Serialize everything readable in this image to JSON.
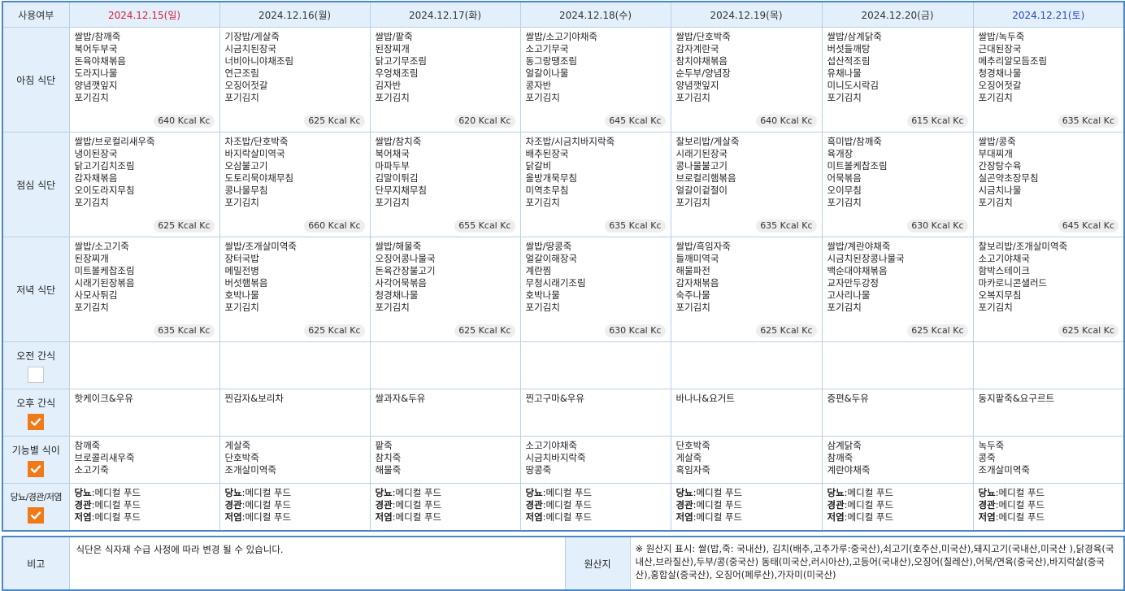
{
  "header": {
    "corner": "사용여부",
    "days": [
      {
        "date": "2024.12.15(일)",
        "type": "sun"
      },
      {
        "date": "2024.12.16(월)",
        "type": "weekday"
      },
      {
        "date": "2024.12.17(화)",
        "type": "weekday"
      },
      {
        "date": "2024.12.18(수)",
        "type": "weekday"
      },
      {
        "date": "2024.12.19(목)",
        "type": "weekday"
      },
      {
        "date": "2024.12.20(금)",
        "type": "weekday"
      },
      {
        "date": "2024.12.21(토)",
        "type": "sat"
      }
    ]
  },
  "rows": {
    "breakfast": {
      "label": "아침 식단",
      "cells": [
        {
          "items": [
            "쌀밥/참깨죽",
            "북어두부국",
            "돈육야채볶음",
            "도라지나물",
            "양념깻잎지",
            "포기김치"
          ],
          "kcal": "640 Kcal Kc"
        },
        {
          "items": [
            "기장밥/게살죽",
            "시금치된장국",
            "너비아니야채조림",
            "연근조림",
            "오징어젓갈",
            "포기김치"
          ],
          "kcal": "625 Kcal Kc"
        },
        {
          "items": [
            "쌀밥/팥죽",
            "된장찌개",
            "닭고기무조림",
            "우엉채조림",
            "김자반",
            "포기김치"
          ],
          "kcal": "620 Kcal Kc"
        },
        {
          "items": [
            "쌀밥/소고기야채죽",
            "소고기무국",
            "동그랑땡조림",
            "얼갈이나물",
            "콩자반",
            "포기김치"
          ],
          "kcal": "645 Kcal Kc"
        },
        {
          "items": [
            "쌀밥/단호박죽",
            "감자계란국",
            "참치야채볶음",
            "순두부/양념장",
            "양념깻잎지",
            "포기김치"
          ],
          "kcal": "640 Kcal Kc"
        },
        {
          "items": [
            "쌀밥/삼계닭죽",
            "버섯들깨탕",
            "섭산적조림",
            "유채나물",
            "미니도시락김",
            "포기김치"
          ],
          "kcal": "615 Kcal Kc"
        },
        {
          "items": [
            "쌀밥/녹두죽",
            "근대된장국",
            "메추리알모듬조림",
            "청경채나물",
            "오징어젓갈",
            "포기김치"
          ],
          "kcal": "635 Kcal Kc"
        }
      ]
    },
    "lunch": {
      "label": "점심 식단",
      "cells": [
        {
          "items": [
            "쌀밥/브로컬리새우죽",
            "냉이된장국",
            "닭고기김치조림",
            "감자채볶음",
            "오이도라지무침",
            "포기김치"
          ],
          "kcal": "625 Kcal Kc"
        },
        {
          "items": [
            "차조밥/단호박죽",
            "바지락살미역국",
            "오삼불고기",
            "도토리묵야채무침",
            "콩나물무침",
            "포기김치"
          ],
          "kcal": "660 Kcal Kc"
        },
        {
          "items": [
            "쌀밥/참치죽",
            "북어채국",
            "마파두부",
            "김말이튀김",
            "단무지채무침",
            "포기김치"
          ],
          "kcal": "655 Kcal Kc"
        },
        {
          "items": [
            "차조밥/시금치바지락죽",
            "배추된장국",
            "닭갈비",
            "올방개묵무침",
            "미역초무침",
            "포기김치"
          ],
          "kcal": "635 Kcal Kc"
        },
        {
          "items": [
            "찰보리밥/게살죽",
            "시래기된장국",
            "콩나물불고기",
            "브로컬리햄볶음",
            "얼갈이겉절이",
            "포기김치"
          ],
          "kcal": "635 Kcal Kc"
        },
        {
          "items": [
            "흑미밥/참깨죽",
            "육개장",
            "미트볼케찹조림",
            "어묵볶음",
            "오이무침",
            "포기김치"
          ],
          "kcal": "630 Kcal Kc"
        },
        {
          "items": [
            "쌀밥/콩죽",
            "부대찌개",
            "간장탕수육",
            "실곤약초장무침",
            "시금치나물",
            "포기김치"
          ],
          "kcal": "645 Kcal Kc"
        }
      ]
    },
    "dinner": {
      "label": "저녁 식단",
      "cells": [
        {
          "items": [
            "쌀밥/소고기죽",
            "된장찌개",
            "미트볼케찹조림",
            "시래기된장볶음",
            "사모사튀김",
            "포기김치"
          ],
          "kcal": "635 Kcal Kc"
        },
        {
          "items": [
            "쌀밥/조개살미역죽",
            "장터국밥",
            "메밀전병",
            "버섯햄볶음",
            "호박나물",
            "포기김치"
          ],
          "kcal": "625 Kcal Kc"
        },
        {
          "items": [
            "쌀밥/해물죽",
            "오징어콩나물국",
            "돈육간장불고기",
            "사각어묵볶음",
            "청경채나물",
            "포기김치"
          ],
          "kcal": "625 Kcal Kc"
        },
        {
          "items": [
            "쌀밥/땅콩죽",
            "얼갈이해장국",
            "계란찜",
            "무청시래기조림",
            "호박나물",
            "포기김치"
          ],
          "kcal": "630 Kcal Kc"
        },
        {
          "items": [
            "쌀밥/흑임자죽",
            "들깨미역국",
            "해물파전",
            "감자채볶음",
            "숙주나물",
            "포기김치"
          ],
          "kcal": "625 Kcal Kc"
        },
        {
          "items": [
            "쌀밥/계란야채죽",
            "시금치된장콩나물국",
            "백순대야채볶음",
            "교자만두강정",
            "고사리나물",
            "포기김치"
          ],
          "kcal": "625 Kcal Kc"
        },
        {
          "items": [
            "찰보리밥/조개살미역죽",
            "소고기야채국",
            "함박스테이크",
            "마카로니콘샐러드",
            "오복지무침",
            "포기김치"
          ],
          "kcal": "625 Kcal Kc"
        }
      ]
    },
    "am_snack": {
      "label": "오전 간식",
      "checked": false,
      "cells": [
        [],
        [],
        [],
        [],
        [],
        [],
        []
      ]
    },
    "pm_snack": {
      "label": "오후 간식",
      "checked": true,
      "cells": [
        [
          "핫케이크&우유"
        ],
        [
          "찐감자&보리차"
        ],
        [
          "쌀과자&두유"
        ],
        [
          "찐고구마&우유"
        ],
        [
          "바나나&요거트"
        ],
        [
          "증편&두유"
        ],
        [
          "동지팥죽&요구르트"
        ]
      ]
    },
    "functional": {
      "label": "기능별 식이",
      "checked": true,
      "cells": [
        [
          "참깨죽",
          "브로콜리새우죽",
          "소고기죽"
        ],
        [
          "게살죽",
          "단호박죽",
          "조개살미역죽"
        ],
        [
          "팥죽",
          "참치죽",
          "해물죽"
        ],
        [
          "소고기야채죽",
          "시금치바지락죽",
          "땅콩죽"
        ],
        [
          "단호박죽",
          "게살죽",
          "흑임자죽"
        ],
        [
          "삼계닭죽",
          "참깨죽",
          "계란야채죽"
        ],
        [
          "녹두죽",
          "콩죽",
          "조개살미역죽"
        ]
      ]
    },
    "special": {
      "label": "당뇨/경관/저염",
      "checked": true,
      "cells": [
        [
          {
            "k": "당뇨",
            "v": ":메디컬 푸드"
          },
          {
            "k": "경관",
            "v": ":메디컬 푸드"
          },
          {
            "k": "저염",
            "v": ":메디컬 푸드"
          }
        ],
        [
          {
            "k": "당뇨",
            "v": ":메디컬 푸드"
          },
          {
            "k": "경관",
            "v": ":메디컬 푸드"
          },
          {
            "k": "저염",
            "v": ":메디컬 푸드"
          }
        ],
        [
          {
            "k": "당뇨",
            "v": ":메디컬 푸드"
          },
          {
            "k": "경관",
            "v": ":메디컬 푸드"
          },
          {
            "k": "저염",
            "v": ":메디컬 푸드"
          }
        ],
        [
          {
            "k": "당뇨",
            "v": ":메디컬 푸드"
          },
          {
            "k": "경관",
            "v": ":메디컬 푸드"
          },
          {
            "k": "저염",
            "v": ":메디컬 푸드"
          }
        ],
        [
          {
            "k": "당뇨",
            "v": ":메디컬 푸드"
          },
          {
            "k": "경관",
            "v": ":메디컬 푸드"
          },
          {
            "k": "저염",
            "v": ":메디컬 푸드"
          }
        ],
        [
          {
            "k": "당뇨",
            "v": ":메디컬 푸드"
          },
          {
            "k": "경관",
            "v": ":메디컬 푸드"
          },
          {
            "k": "저염",
            "v": ":메디컬 푸드"
          }
        ],
        [
          {
            "k": "당뇨",
            "v": ":메디컬 푸드"
          },
          {
            "k": "경관",
            "v": ":메디컬 푸드"
          },
          {
            "k": "저염",
            "v": ":메디컬 푸드"
          }
        ]
      ]
    }
  },
  "notes": {
    "remark_label": "비고",
    "remark_text": "식단은 식자재 수급 사정에 따라 변경 될 수 있습니다.",
    "origin_label": "원산지",
    "origin_text": "※ 원산지 표시: 쌀(밥,죽: 국내산), 김치(배추,고추가루:중국산),쇠고기(호주산,미국산),돼지고기(국내산,미국산 ),닭경육(국내산,브라질산),두부/콩(중국산) 동태(미국산,러시아산),고등어(국내산),오징어(칠레산),어묵/연육(중국산),바지락살(중국산),홍합살(중국산), 오징어(페루산),가자미(미국산)"
  },
  "colors": {
    "accent": "#4a86c8",
    "header_bg": "#e3f0fb",
    "sunday": "#d6203a",
    "saturday": "#2546c8",
    "checkbox_on": "#f07a17"
  }
}
